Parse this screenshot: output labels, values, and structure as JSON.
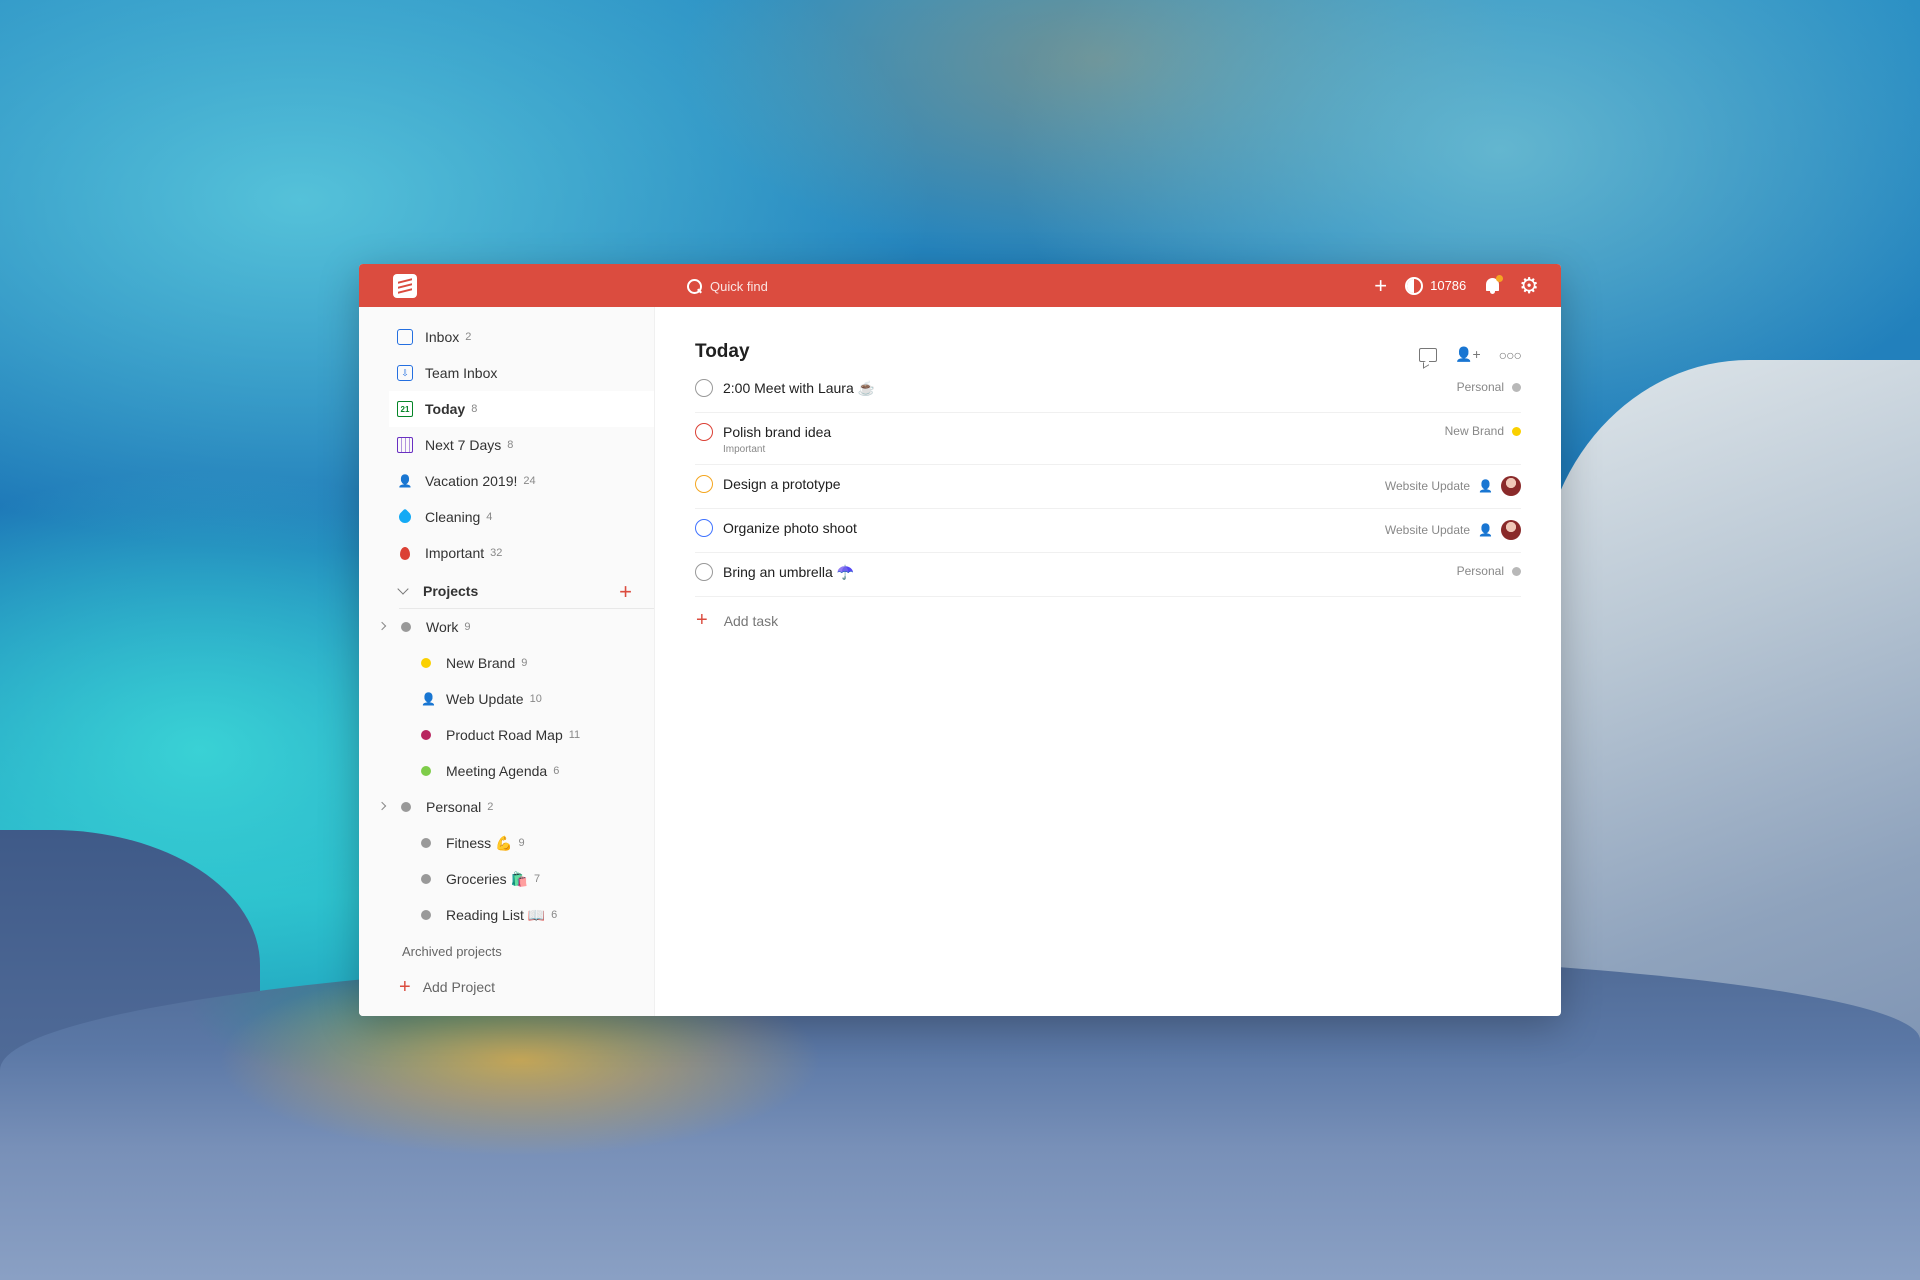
{
  "topbar": {
    "search_placeholder": "Quick find",
    "karma_value": "10786",
    "accent_color": "#db4c3f"
  },
  "sidebar": {
    "filters": [
      {
        "label": "Inbox",
        "count": "2",
        "icon": "inbox-icon"
      },
      {
        "label": "Team Inbox",
        "count": "",
        "icon": "team-inbox-icon"
      },
      {
        "label": "Today",
        "count": "8",
        "icon": "calendar-today-icon"
      },
      {
        "label": "Next 7 Days",
        "count": "8",
        "icon": "calendar-week-icon"
      },
      {
        "label": "Vacation 2019!",
        "count": "24",
        "icon": "person-icon"
      },
      {
        "label": "Cleaning",
        "count": "4",
        "icon": "tag-icon"
      },
      {
        "label": "Important",
        "count": "32",
        "icon": "drop-icon"
      }
    ],
    "projects_heading": "Projects",
    "projects": [
      {
        "label": "Work",
        "count": "9",
        "color": "#999999"
      },
      {
        "label": "New Brand",
        "count": "9",
        "color": "#fad000"
      },
      {
        "label": "Web Update",
        "count": "10",
        "color": "#246fe0"
      },
      {
        "label": "Product Road Map",
        "count": "11",
        "color": "#b8255f"
      },
      {
        "label": "Meeting Agenda",
        "count": "6",
        "color": "#7ecc49"
      },
      {
        "label": "Personal",
        "count": "2",
        "color": "#999999"
      },
      {
        "label": "Fitness 💪",
        "count": "9",
        "color": "#999999"
      },
      {
        "label": "Groceries 🛍️",
        "count": "7",
        "color": "#999999"
      },
      {
        "label": "Reading List 📖",
        "count": "6",
        "color": "#999999"
      }
    ],
    "archived_label": "Archived projects",
    "add_project_label": "Add Project"
  },
  "main": {
    "title": "Today",
    "tasks": [
      {
        "title": "2:00 Meet with Laura ☕",
        "sub": "",
        "project": "Personal",
        "check_color": "#999999",
        "project_color": "#b8b8b8"
      },
      {
        "title": "Polish brand idea",
        "sub": "Important",
        "project": "New Brand",
        "check_color": "#db4035",
        "project_color": "#fad000"
      },
      {
        "title": "Design a prototype",
        "sub": "",
        "project": "Website Update",
        "check_color": "#f4a620",
        "project_color": "#246fe0"
      },
      {
        "title": "Organize photo shoot",
        "sub": "",
        "project": "Website Update",
        "check_color": "#4073ff",
        "project_color": "#246fe0"
      },
      {
        "title": "Bring an umbrella ☂️",
        "sub": "",
        "project": "Personal",
        "check_color": "#999999",
        "project_color": "#b8b8b8"
      }
    ],
    "add_task_label": "Add task"
  }
}
